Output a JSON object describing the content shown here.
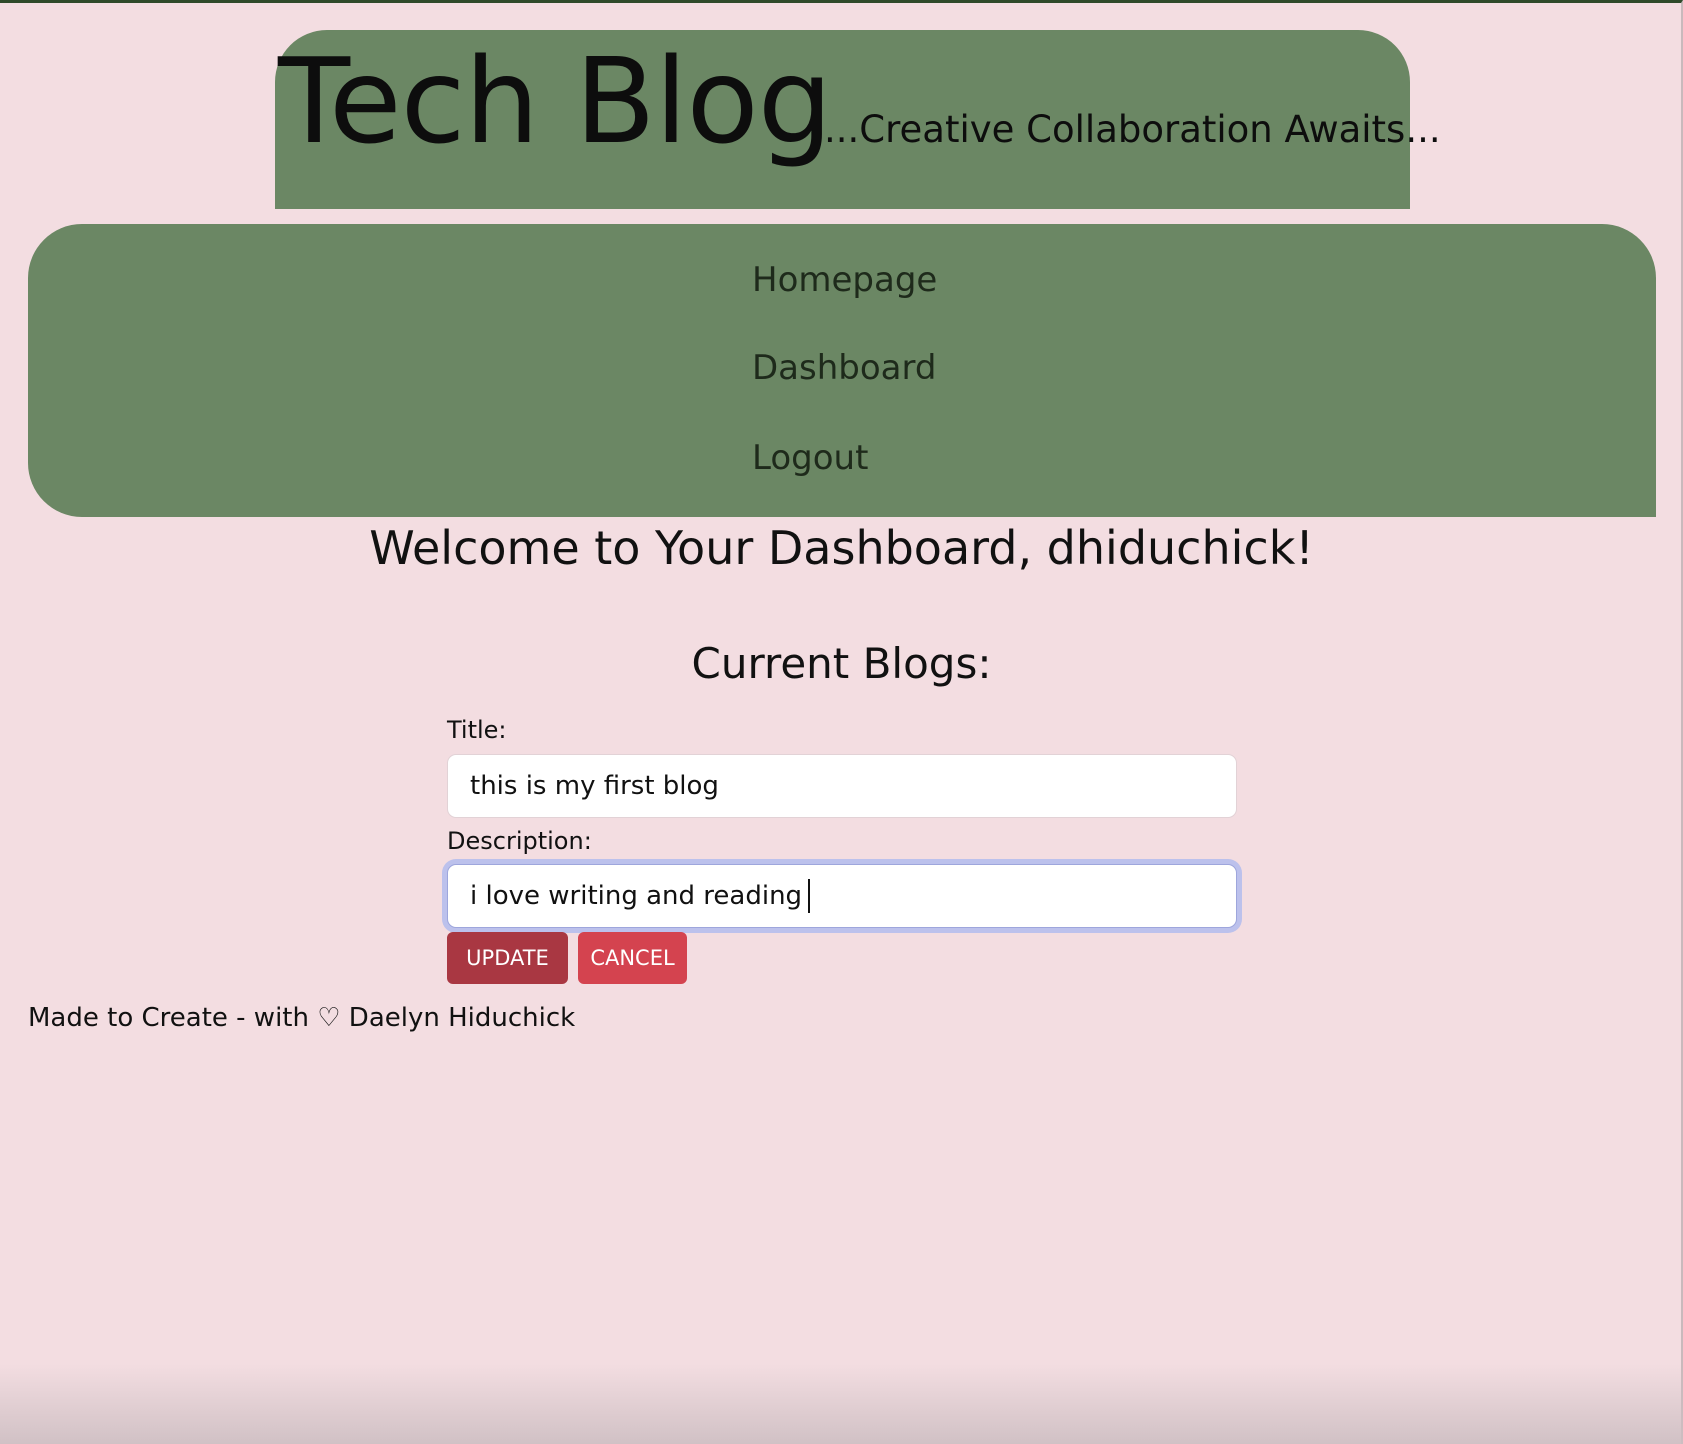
{
  "header": {
    "title": "Tech Blog",
    "tagline": "...Creative Collaboration Awaits..."
  },
  "nav": {
    "items": [
      {
        "label": "Homepage"
      },
      {
        "label": "Dashboard"
      },
      {
        "label": "Logout"
      }
    ]
  },
  "main": {
    "welcome": "Welcome to Your Dashboard, dhiduchick!",
    "section_heading": "Current Blogs:"
  },
  "form": {
    "title_label": "Title:",
    "title_value": "this is my first blog",
    "description_label": "Description:",
    "description_value": "i love writing and reading",
    "update_label": "Update",
    "cancel_label": "Cancel"
  },
  "footer": {
    "text": "Made to Create - with ♡ Daelyn Hiduchick"
  },
  "colors": {
    "background": "#f3dde1",
    "panel": "#6b8764",
    "update_button": "#a93742",
    "cancel_button": "#d4434f",
    "focus_ring": "#bcc1ec"
  }
}
